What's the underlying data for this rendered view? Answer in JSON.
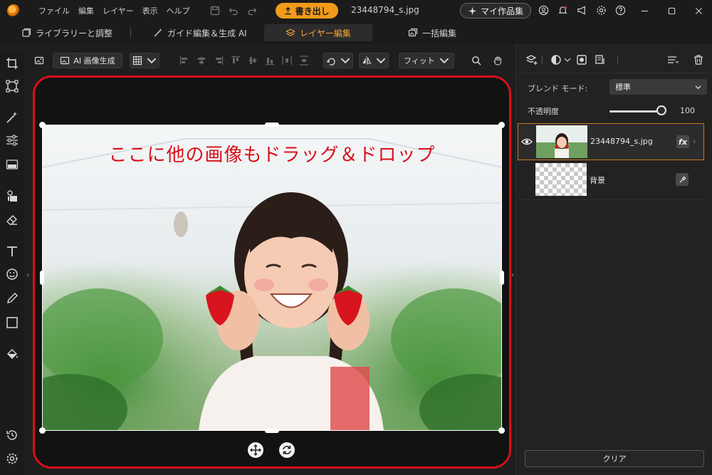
{
  "menu": [
    "ファイル",
    "編集",
    "レイヤー",
    "表示",
    "ヘルプ"
  ],
  "export_label": "書き出し",
  "doc_title": "23448794_s.jpg",
  "mywork_label": "マイ作品集",
  "tabs": [
    {
      "label": "ライブラリーと調整"
    },
    {
      "label": "ガイド編集＆生成 AI"
    },
    {
      "label": "レイヤー編集"
    },
    {
      "label": "一括編集"
    }
  ],
  "canvas_toolbar": {
    "ai_label": "AI 画像生成",
    "fit_label": "フィット"
  },
  "canvas": {
    "drop_text": "ここに他の画像もドラッグ＆ドロップ"
  },
  "panel": {
    "blend_label": "ブレンド モード:",
    "blend_value": "標準",
    "opacity_label": "不透明度",
    "opacity_value": "100",
    "layers": [
      {
        "name": "23448794_s.jpg",
        "fx": "fx"
      },
      {
        "name": "背景"
      }
    ],
    "clear_label": "クリア"
  },
  "colors": {
    "accent": "#f29a1a",
    "drop_frame": "#d8101a",
    "selected_layer_border": "#c47a1e"
  }
}
